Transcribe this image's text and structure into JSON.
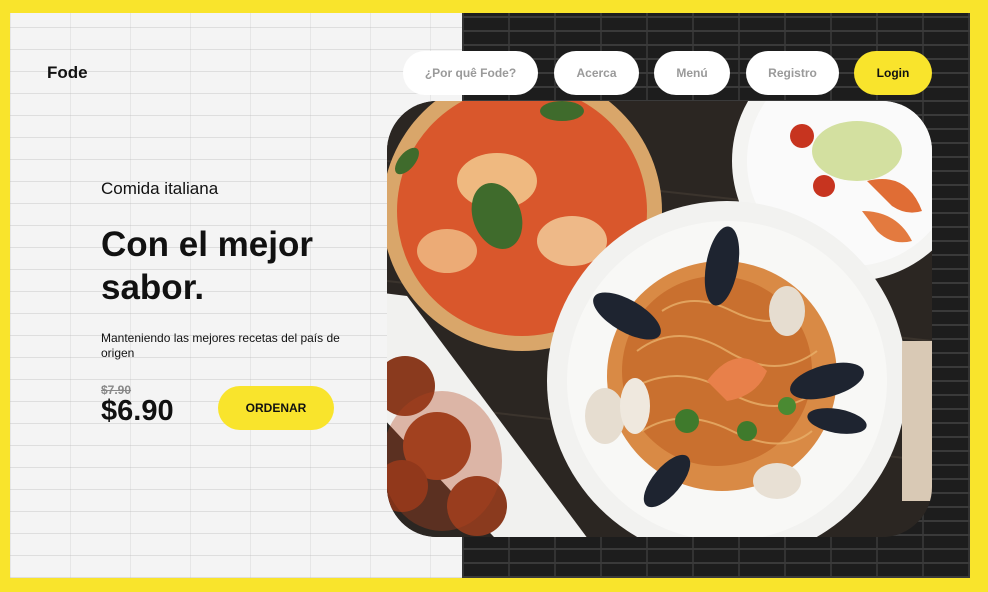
{
  "brand": {
    "name": "Fode"
  },
  "nav": {
    "items": [
      {
        "label": "¿Por quê Fode?"
      },
      {
        "label": "Acerca"
      },
      {
        "label": "Menú"
      },
      {
        "label": "Registro"
      }
    ],
    "login_label": "Login"
  },
  "hero": {
    "kicker": "Comida italiana",
    "headline_line1": "Con el mejor",
    "headline_line2": "sabor.",
    "description": "Manteniendo las mejores recetas del país de origen",
    "old_price": "$7.90",
    "price": "$6.90",
    "order_label": "ORDENAR"
  },
  "image": {
    "subject": "italian-food-photo",
    "items": [
      "pizza",
      "seafood-pasta",
      "shrimp-salad",
      "meatballs"
    ]
  },
  "colors": {
    "accent": "#f9e42c",
    "text": "#111111",
    "muted": "#9a9a9a"
  }
}
